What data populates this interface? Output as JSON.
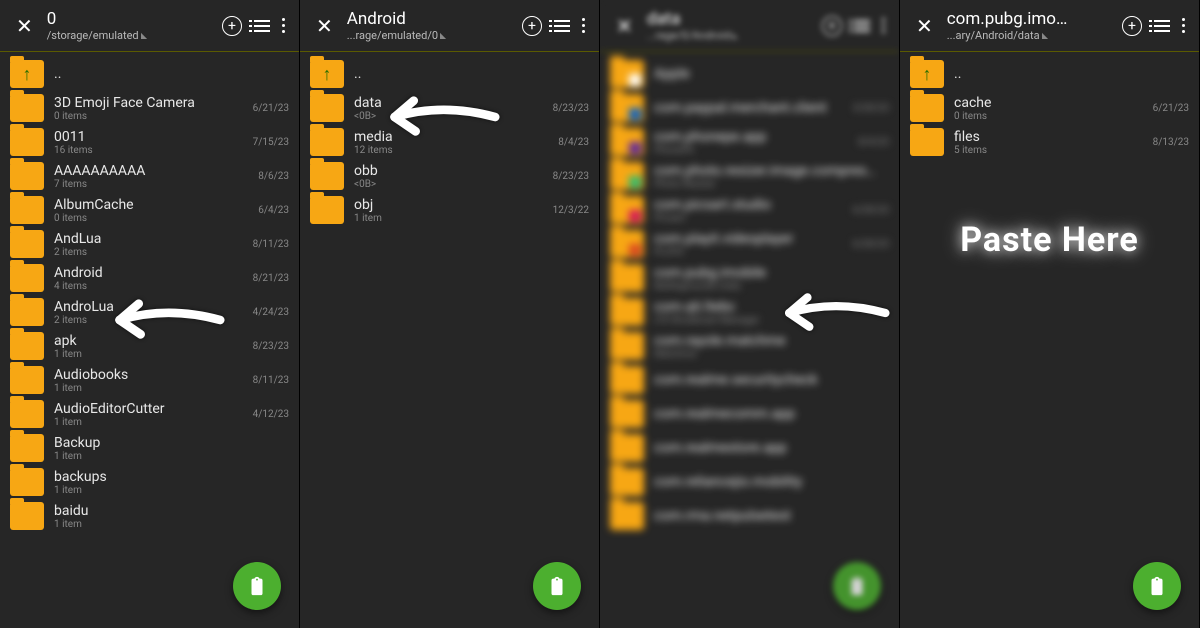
{
  "panels": [
    {
      "title": "0",
      "path": "/storage/emulated",
      "items": [
        {
          "name": "..",
          "meta": "",
          "date": "",
          "up": true
        },
        {
          "name": "3D Emoji Face Camera",
          "meta": "0 items",
          "date": "6/21/23"
        },
        {
          "name": "0011",
          "meta": "16 items",
          "date": "7/15/23"
        },
        {
          "name": "AAAAAAAAAA",
          "meta": "7 items",
          "date": "8/6/23"
        },
        {
          "name": "AlbumCache",
          "meta": "0 items",
          "date": "6/4/23"
        },
        {
          "name": "AndLua",
          "meta": "2 items",
          "date": "8/11/23"
        },
        {
          "name": "Android",
          "meta": "4 items",
          "date": "8/21/23",
          "arrow": true
        },
        {
          "name": "AndroLua",
          "meta": "2 items",
          "date": "4/24/23"
        },
        {
          "name": "apk",
          "meta": "1 item",
          "date": "8/23/23"
        },
        {
          "name": "Audiobooks",
          "meta": "1 item",
          "date": "8/11/23"
        },
        {
          "name": "AudioEditorCutter",
          "meta": "1 item",
          "date": "4/12/23"
        },
        {
          "name": "Backup",
          "meta": "1 item",
          "date": ""
        },
        {
          "name": "backups",
          "meta": "1 item",
          "date": ""
        },
        {
          "name": "baidu",
          "meta": "1 item",
          "date": ""
        }
      ]
    },
    {
      "title": "Android",
      "path": "...rage/emulated/0",
      "items": [
        {
          "name": "..",
          "meta": "",
          "date": "",
          "up": true
        },
        {
          "name": "data",
          "meta": "<0B>",
          "date": "8/23/23",
          "arrow": true
        },
        {
          "name": "media",
          "meta": "12 items",
          "date": "8/4/23"
        },
        {
          "name": "obb",
          "meta": "<0B>",
          "date": "8/23/23"
        },
        {
          "name": "obj",
          "meta": "1 item",
          "date": "12/3/22"
        }
      ]
    },
    {
      "title": "data",
      "path": "...rage/0/Android",
      "items": [
        {
          "name": "Apple",
          "meta": "",
          "date": "",
          "badge": "#fff"
        },
        {
          "name": "com.paypal.merchant.client",
          "meta": "",
          "date": "3/20/23",
          "badge": "#0b62c4"
        },
        {
          "name": "com.phonepe.app",
          "meta": "PhonePe",
          "date": "8/4/23",
          "badge": "#5f259f"
        },
        {
          "name": "com.photo.resizer.image.compressor",
          "meta": "Photo Resizer",
          "date": "",
          "badge": "#2dbc6f"
        },
        {
          "name": "com.picsart.studio",
          "meta": "Picsart",
          "date": "6/20/23",
          "badge": "#d4145a"
        },
        {
          "name": "com.playit.videoplayer",
          "meta": "PLAYit",
          "date": "6/20/23",
          "badge": "#d94721"
        },
        {
          "name": "com.pubg.imobile",
          "meta": "Battlegrounds India",
          "date": "",
          "arrow": true,
          "badge": "#f7a714"
        },
        {
          "name": "com.qti.ltebc",
          "meta": "LTE Broadcast Manager",
          "date": ""
        },
        {
          "name": "com.rayole.matchme",
          "meta": "Matchme",
          "date": ""
        },
        {
          "name": "com.realme.securitycheck",
          "meta": "",
          "date": ""
        },
        {
          "name": "com.realmecomm.app",
          "meta": "",
          "date": ""
        },
        {
          "name": "com.realmestore.app",
          "meta": "",
          "date": ""
        },
        {
          "name": "com.reliancejio.mobility",
          "meta": "",
          "date": ""
        },
        {
          "name": "com.rma.netpulsetest",
          "meta": "",
          "date": ""
        }
      ]
    },
    {
      "title": "com.pubg.imo…",
      "path": "...ary/Android/data",
      "paste_label": "Paste Here",
      "items": [
        {
          "name": "..",
          "meta": "",
          "date": "",
          "up": true
        },
        {
          "name": "cache",
          "meta": "0 items",
          "date": "6/21/23"
        },
        {
          "name": "files",
          "meta": "5 items",
          "date": "8/13/23"
        }
      ]
    }
  ]
}
